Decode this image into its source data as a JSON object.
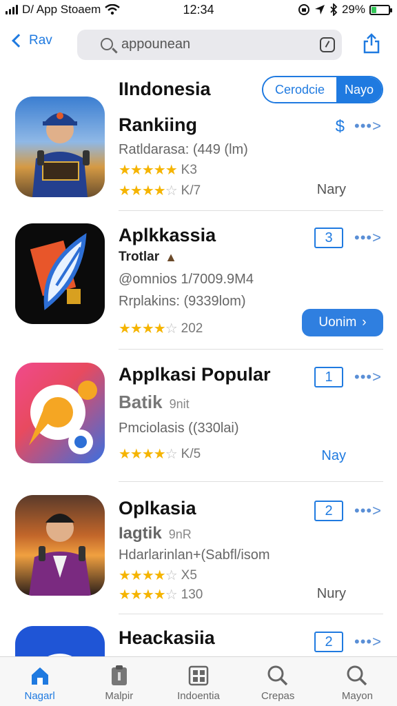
{
  "status_bar": {
    "carrier": "D/ App Stoaem",
    "time": "12:34",
    "battery": "29%",
    "battery_level": 0.29
  },
  "nav": {
    "back_label": "Rav",
    "search_placeholder": "appounean"
  },
  "segmented": {
    "left_label": "Cerodcie",
    "right_label": "Nayo"
  },
  "rows": [
    {
      "title": "IIndonesia",
      "subtitle": "Rankiing",
      "meta": "Ratldarasa: (449 (lm)",
      "rating_a": "K3",
      "rating_b": "K/7",
      "right_symbol": "$",
      "right_label": "Nary",
      "more": "•••>"
    },
    {
      "title": "Aplkkassia",
      "subtitle": "Trotlar",
      "meta1": "@omnios 1/7009.9M4",
      "meta2": "Rrplakins: (9339lom)",
      "rating": "202",
      "rank": "3",
      "get_label": "Uonim",
      "more": "•••>"
    },
    {
      "title": "Applkasi Popular",
      "subtitle": "Batik",
      "subtitle_extra": "9nit",
      "meta": "Pmciolasis ((330lai)",
      "rating": "K/5",
      "rank": "1",
      "right_label": "Nay",
      "more": "•••>"
    },
    {
      "title": "Oplkasia",
      "subtitle": "Iagtik",
      "subtitle_extra": "9nR",
      "meta": "Hdarlarinlan+(Sabfl/isom",
      "rating_a": "X5",
      "rating_b": "130",
      "rank": "2",
      "right_label": "Nury",
      "more": "•••>"
    },
    {
      "title": "Heackasiia",
      "rank": "2",
      "more": "•••>"
    }
  ],
  "tabs": [
    {
      "label": "Nagarl",
      "icon": "home-icon"
    },
    {
      "label": "Malpir",
      "icon": "clipboard-icon"
    },
    {
      "label": "Indoentia",
      "icon": "grid-icon"
    },
    {
      "label": "Crepas",
      "icon": "search-icon"
    },
    {
      "label": "Mayon",
      "icon": "search-icon"
    }
  ],
  "colors": {
    "accent": "#1f7ae0",
    "star": "#f5b400"
  }
}
